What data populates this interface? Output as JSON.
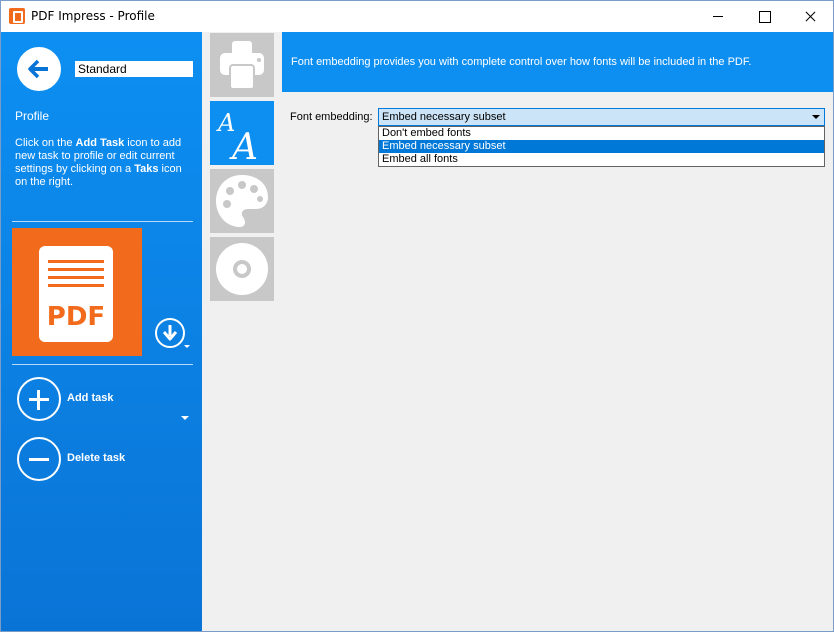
{
  "window": {
    "title": "PDF Impress - Profile"
  },
  "sidebar": {
    "profile_name": "Standard",
    "heading": "Profile",
    "desc": {
      "p1": "Click on the ",
      "b1": "Add Task",
      "p2": " icon to add new task to profile or edit current settings by clicking on a ",
      "b2": "Taks",
      "p3": " icon on the right."
    },
    "pdf_tile_label": "PDF",
    "add_task_label": "Add task",
    "delete_task_label": "Delete task"
  },
  "tabs": [
    {
      "icon": "printer-icon"
    },
    {
      "icon": "font-icon",
      "active": true
    },
    {
      "icon": "palette-icon"
    },
    {
      "icon": "disc-icon"
    }
  ],
  "content": {
    "banner_text": "Font embedding provides you with complete control over how fonts will be included in the PDF.",
    "font_embedding": {
      "label": "Font embedding:",
      "selected": "Embed necessary subset",
      "options": [
        "Don't embed fonts",
        "Embed necessary subset",
        "Embed all fonts"
      ],
      "selected_index": 1
    }
  },
  "colors": {
    "accent_blue": "#0d8ff2",
    "pdf_orange": "#f26a1b",
    "selection_blue": "#0078d7"
  }
}
